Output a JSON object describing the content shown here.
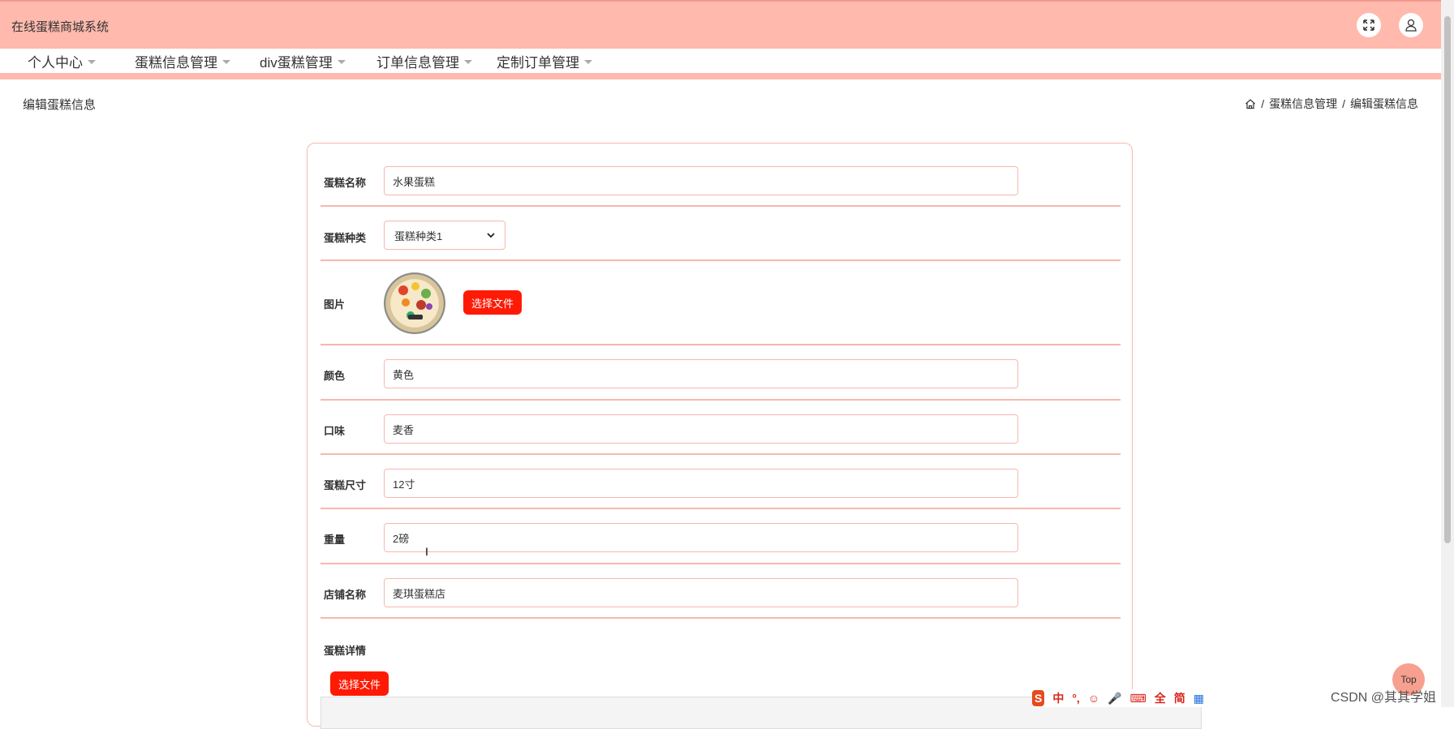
{
  "app": {
    "title": "在线蛋糕商城系统"
  },
  "header": {
    "fullscreen_icon": "fullscreen-icon",
    "user_icon": "user-icon"
  },
  "nav": {
    "items": [
      {
        "label": "个人中心"
      },
      {
        "label": "蛋糕信息管理"
      },
      {
        "label": "div蛋糕管理"
      },
      {
        "label": "订单信息管理"
      },
      {
        "label": "定制订单管理"
      }
    ]
  },
  "page": {
    "title": "编辑蛋糕信息",
    "breadcrumb": [
      "蛋糕信息管理",
      "编辑蛋糕信息"
    ],
    "breadcrumb_sep": "/"
  },
  "form": {
    "name": {
      "label": "蛋糕名称",
      "value": "水果蛋糕"
    },
    "type": {
      "label": "蛋糕种类",
      "value": "蛋糕种类1"
    },
    "image": {
      "label": "图片",
      "button": "选择文件"
    },
    "color": {
      "label": "颜色",
      "value": "黄色"
    },
    "flavor": {
      "label": "口味",
      "value": "麦香"
    },
    "size": {
      "label": "蛋糕尺寸",
      "value": "12寸"
    },
    "weight": {
      "label": "重量",
      "value": "2磅"
    },
    "shop": {
      "label": "店铺名称",
      "value": "麦琪蛋糕店"
    },
    "detail": {
      "label": "蛋糕详情",
      "button": "选择文件"
    }
  },
  "float": {
    "top_label": "Top"
  },
  "ime": {
    "items": [
      "中",
      "°,",
      "☺",
      "🎤",
      "⌨",
      "全",
      "简",
      "▦"
    ]
  },
  "watermark": "CSDN @其其学姐",
  "colors": {
    "header_bg": "#ffb9ad",
    "accent_red": "#ff1a05",
    "border_pink": "#f6b8ad"
  }
}
